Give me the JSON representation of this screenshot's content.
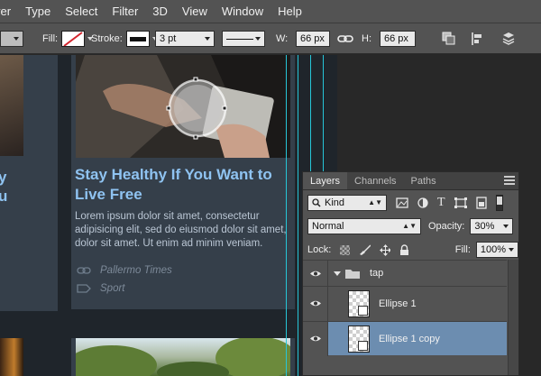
{
  "menubar": {
    "items": [
      "yer",
      "Type",
      "Select",
      "Filter",
      "3D",
      "View",
      "Window",
      "Help"
    ]
  },
  "options": {
    "fill_label": "Fill:",
    "stroke_label": "Stroke:",
    "stroke_width": "3 pt",
    "w_label": "W:",
    "w_value": "66 px",
    "h_label": "H:",
    "h_value": "66 px"
  },
  "canvas": {
    "card_left": {
      "fragments": [
        "y",
        "u"
      ]
    },
    "card_main": {
      "title": "Stay Healthy If You Want to Live Free",
      "body": "Lorem ipsum dolor sit amet, consectetur adipisicing elit, sed do eiusmod dolor sit amet, dolor sit amet. Ut enim ad minim veniam.",
      "meta": [
        {
          "icon": "link-icon",
          "text": "Pallermo Times"
        },
        {
          "icon": "tag-icon",
          "text": "Sport"
        }
      ]
    }
  },
  "layers_panel": {
    "tabs": [
      "Layers",
      "Channels",
      "Paths"
    ],
    "active_tab": "Layers",
    "filter_kind": "Kind",
    "blend_mode": "Normal",
    "opacity_label": "Opacity:",
    "opacity_value": "30%",
    "lock_label": "Lock:",
    "fill_label": "Fill:",
    "fill_value": "100%",
    "layers": [
      {
        "name": "tap",
        "type": "group",
        "selected": false
      },
      {
        "name": "Ellipse 1",
        "type": "shape",
        "selected": false
      },
      {
        "name": "Ellipse 1 copy",
        "type": "shape",
        "selected": true
      }
    ]
  },
  "colors": {
    "accent_title": "#8fc3f1",
    "guide": "#26c6d8",
    "selected_row": "#6c8db0"
  }
}
